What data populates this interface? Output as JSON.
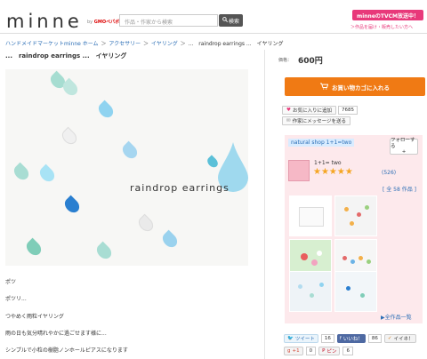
{
  "header": {
    "logo": "minne",
    "logo_by": "by",
    "logo_brand": "GMOペパボ",
    "search_placeholder": "作品・作家から検索",
    "search_button": "検索",
    "tv_banner": "minneのTVCM放送中！",
    "tv_sub": "＞作品を届け・販売したい方へ"
  },
  "breadcrumb": [
    "ハンドメイドマーケットminne ホーム",
    "アクセサリー",
    "イヤリング",
    "...　raindrop earrings ...　イヤリング"
  ],
  "product": {
    "title": "...　raindrop earrings ...　イヤリング",
    "image_text": "raindrop earrings",
    "description": [
      "ポツ",
      "ポツリ...",
      "つやめく雨粒イヤリング",
      "雨の日も気分晴れやかに過ごせます様に...",
      "シンプルで小粒の樹脂ノンホールピアスになります"
    ]
  },
  "purchase": {
    "price_label": "価格：",
    "price": "600円",
    "cart_button": "お買い物カゴに入れる",
    "favorite_button": "お気に入りに追加",
    "favorite_count": "7685",
    "message_button": "作家にメッセージを送る"
  },
  "shop": {
    "name": "natural shop 1+1=two",
    "follow_label": "フォローする",
    "follow_sub": "+",
    "avatar_label": "1+1= two",
    "rating_stars": "★★★★★",
    "rating_count": "(526)",
    "all_works": "[ 全 58 作品 ]",
    "goods_list": "▶全作品一覧"
  },
  "social": {
    "tweet": "ツイート",
    "tweet_count": "16",
    "like": "いいね！",
    "like_count": "86",
    "iine": "イイネ！",
    "gplus": "+1",
    "gplus_count": "0",
    "pin": "ピン",
    "pin_count": "6"
  },
  "colors": {
    "accent": "#f07a14",
    "pink": "#e8387a",
    "link": "#2a6db5"
  }
}
